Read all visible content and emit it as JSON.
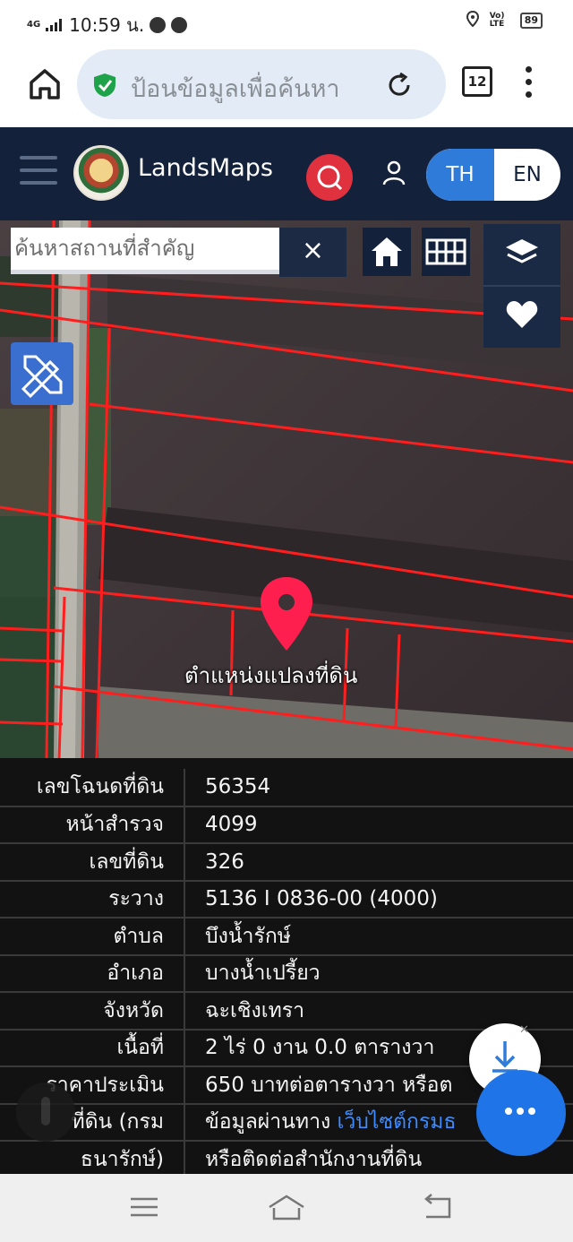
{
  "status_bar": {
    "network": "4G",
    "time": "10:59 น.",
    "volte": "Vo) LTE",
    "battery": "89"
  },
  "browser": {
    "search_placeholder": "ป้อนข้อมูลเพื่อค้นหา",
    "tab_count": "12"
  },
  "app_header": {
    "brand": "LandsMaps",
    "lang_th": "TH",
    "lang_en": "EN"
  },
  "map": {
    "search_placeholder": "ค้นหาสถานที่สำคัญ",
    "clear_label": "×",
    "pin_label": "ตำแหน่งแปลงที่ดิน",
    "parcel_line_color": "#ff1e1e",
    "pin_color": "#ff1f4f"
  },
  "land_info": {
    "rows": [
      {
        "label": "เลขโฉนดที่ดิน",
        "value": "56354"
      },
      {
        "label": "หน้าสำรวจ",
        "value": "4099"
      },
      {
        "label": "เลขที่ดิน",
        "value": "326"
      },
      {
        "label": "ระวาง",
        "value": "5136 I 0836-00 (4000)"
      },
      {
        "label": "ตำบล",
        "value": "บึงน้ำรักษ์"
      },
      {
        "label": "อำเภอ",
        "value": "บางน้ำเปรี้ยว"
      },
      {
        "label": "จังหวัด",
        "value": "ฉะเชิงเทรา"
      },
      {
        "label": "เนื้อที่",
        "value": "2 ไร่ 0 งาน 0.0 ตารางวา"
      },
      {
        "label": "ราคาประเมิน",
        "value": "650 บาทต่อตารางวา หรือต"
      },
      {
        "label": "ที่ดิน (กรม",
        "value": "ข้อมูลผ่านทาง ",
        "link": "เว็บไซต์กรมธ"
      },
      {
        "label": "ธนารักษ์)",
        "value": "หรือติดต่อสำนักงานที่ดิน"
      }
    ]
  },
  "fab": {
    "close_label": "✕"
  },
  "colors": {
    "header_bg": "#13213b",
    "accent_blue": "#2f7bd9",
    "search_red": "#e0313e",
    "fab_blue": "#1f74e8"
  }
}
